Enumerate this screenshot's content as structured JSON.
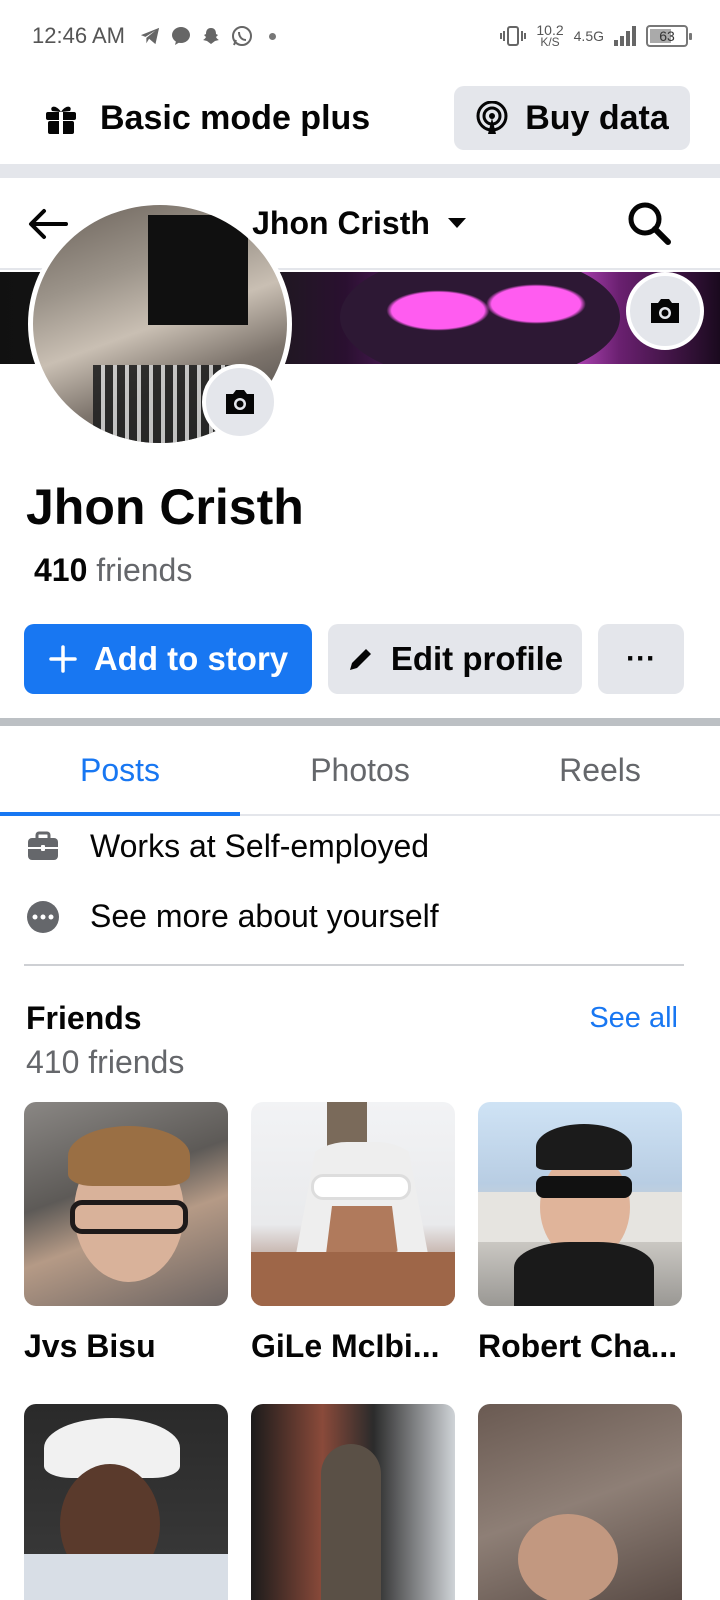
{
  "status_bar": {
    "time": "12:46 AM",
    "net_speed": "10.2",
    "net_unit": "K/S",
    "network": "4.5G",
    "battery": "63"
  },
  "basic_bar": {
    "title": "Basic mode plus",
    "buy_label": "Buy data"
  },
  "nav": {
    "title": "Jhon Cristh"
  },
  "profile": {
    "name": "Jhon Cristh",
    "friend_count": "410",
    "friend_suffix": " friends"
  },
  "actions": {
    "add_story": "Add to story",
    "edit_profile": "Edit profile",
    "more": "···"
  },
  "tabs": [
    {
      "label": "Posts",
      "active": true
    },
    {
      "label": "Photos",
      "active": false
    },
    {
      "label": "Reels",
      "active": false
    }
  ],
  "intro": {
    "work": "Works at Self-employed",
    "see_more": "See more about yourself"
  },
  "friends": {
    "title": "Friends",
    "subtitle": "410 friends",
    "see_all": "See all",
    "list": [
      {
        "name": "Jvs Bisu"
      },
      {
        "name": "GiLe McIbi..."
      },
      {
        "name": "Robert Cha..."
      },
      {
        "name": ""
      },
      {
        "name": ""
      },
      {
        "name": ""
      }
    ]
  },
  "colors": {
    "brand": "#1877f2",
    "secondary_bg": "#e4e6eb",
    "muted_text": "#65676b"
  }
}
